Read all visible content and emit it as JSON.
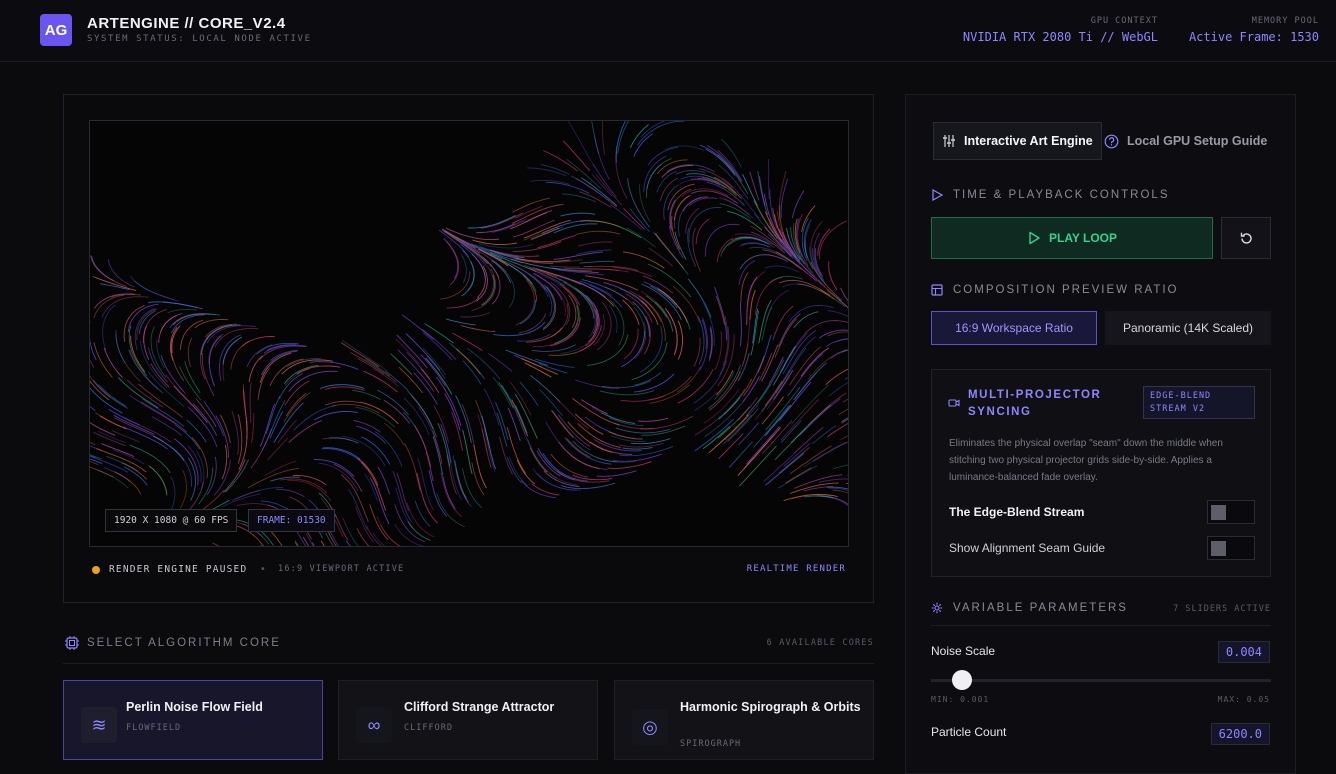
{
  "header": {
    "logo": "AG",
    "title": "ARTENGINE // CORE_V2.4",
    "status": "SYSTEM STATUS: LOCAL NODE ACTIVE",
    "gpu_label": "GPU CONTEXT",
    "gpu_value": "NVIDIA RTX 2080 Ti // WebGL",
    "memory_label": "MEMORY POOL",
    "memory_value": "Active Frame: 1530"
  },
  "canvas": {
    "resolution": "1920 X 1080 @ 60 FPS",
    "frame": "FRAME: 01530",
    "engine_status": "RENDER ENGINE PAUSED",
    "separator": "•",
    "viewport": "16:9 VIEWPORT ACTIVE",
    "mode": "REALTIME RENDER",
    "status_color": "#f0a020"
  },
  "algorithms": {
    "title": "SELECT ALGORITHM CORE",
    "count": "6 AVAILABLE CORES",
    "cards": [
      {
        "title": "Perlin Noise Flow Field",
        "code": "FLOWFIELD",
        "icon": "wind-icon",
        "glyph": "≋"
      },
      {
        "title": "Clifford Strange Attractor",
        "code": "CLIFFORD",
        "icon": "infinity-icon",
        "glyph": "∞"
      },
      {
        "title": "Harmonic Spirograph & Orbits",
        "code": "SPIROGRAPH",
        "icon": "orbit-icon",
        "glyph": "◎"
      }
    ]
  },
  "sidebar": {
    "tabs": [
      "Interactive Art Engine",
      "Local GPU Setup Guide"
    ],
    "playback_title": "TIME & PLAYBACK CONTROLS",
    "play_label": "PLAY LOOP",
    "ratio_title": "COMPOSITION PREVIEW RATIO",
    "ratio_options": [
      "16:9 Workspace Ratio",
      "Panoramic (14K Scaled)"
    ],
    "projector": {
      "title": "MULTI-PROJECTOR SYNCING",
      "badge": "EDGE-BLEND STREAM V2",
      "description": "Eliminates the physical overlap \"seam\" down the middle when stitching two physical projector grids side-by-side. Applies a luminance-balanced fade overlay.",
      "toggles": [
        {
          "label": "The Edge-Blend Stream",
          "on": false
        },
        {
          "label": "Show Alignment Seam Guide",
          "on": false
        }
      ]
    },
    "params": {
      "title": "VARIABLE PARAMETERS",
      "count": "7 SLIDERS ACTIVE",
      "noise_scale": {
        "label": "Noise Scale",
        "value": "0.004",
        "min": "MIN: 0.001",
        "max": "MAX: 0.05",
        "fraction": 0.061
      },
      "particle_count": {
        "label": "Particle Count",
        "value": "6200.0"
      }
    },
    "accent_color": "#8e86ff",
    "play_color": "#33d38a"
  }
}
